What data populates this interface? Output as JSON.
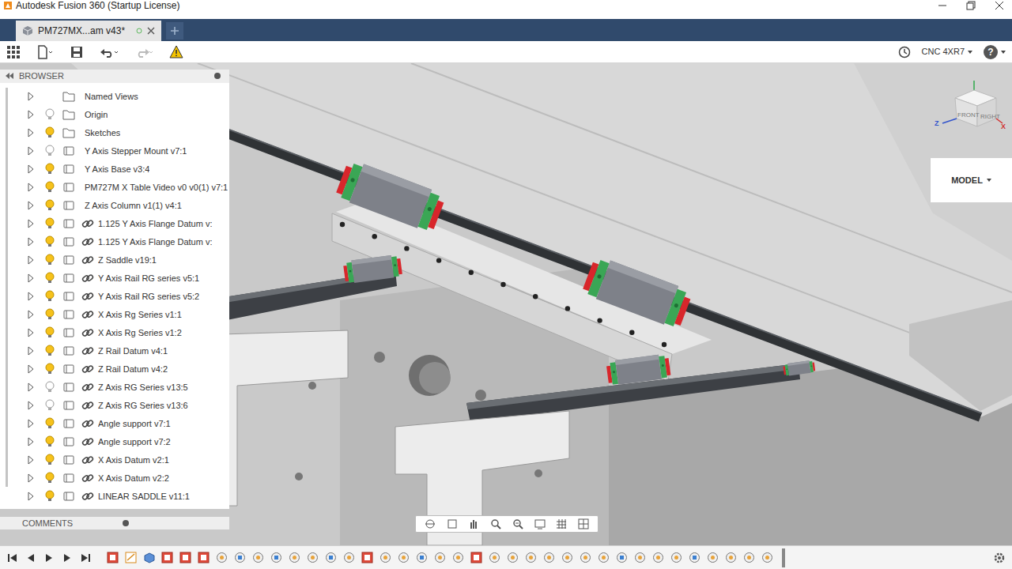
{
  "window": {
    "title": "Autodesk Fusion 360 (Startup License)"
  },
  "tabs": [
    {
      "label": "PM727MX...am v43*",
      "selected": true
    }
  ],
  "toolbar": {
    "workspace": "CNC 4XR7",
    "help": "?"
  },
  "browser": {
    "title": "BROWSER",
    "items": [
      {
        "label": "Named Views",
        "kind": "named-views",
        "visible": false,
        "expanded": false
      },
      {
        "label": "Origin",
        "kind": "folder",
        "visible": false,
        "expanded": false
      },
      {
        "label": "Sketches",
        "kind": "folder",
        "visible": true,
        "expanded": false
      },
      {
        "label": "Y Axis Stepper Mount v7:1",
        "kind": "component",
        "visible": false,
        "expanded": false
      },
      {
        "label": "Y Axis Base v3:4",
        "kind": "component",
        "visible": true,
        "expanded": false
      },
      {
        "label": "PM727M X Table Video v0 v0(1) v7:1",
        "kind": "component",
        "visible": true,
        "expanded": false
      },
      {
        "label": "Z Axis Column v1(1) v4:1",
        "kind": "component",
        "visible": true,
        "expanded": false
      },
      {
        "label": "1.125 Y Axis Flange Datum v:",
        "kind": "linked",
        "visible": true,
        "expanded": false
      },
      {
        "label": "1.125 Y Axis Flange Datum v:",
        "kind": "linked",
        "visible": true,
        "expanded": false
      },
      {
        "label": "Z Saddle v19:1",
        "kind": "linked",
        "visible": true,
        "expanded": false
      },
      {
        "label": "Y Axis Rail RG series v5:1",
        "kind": "linked",
        "visible": true,
        "expanded": false
      },
      {
        "label": "Y Axis Rail RG series v5:2",
        "kind": "linked",
        "visible": true,
        "expanded": false
      },
      {
        "label": "X Axis Rg Series v1:1",
        "kind": "linked",
        "visible": true,
        "expanded": false
      },
      {
        "label": "X Axis Rg Series v1:2",
        "kind": "linked",
        "visible": true,
        "expanded": false
      },
      {
        "label": "Z Rail Datum v4:1",
        "kind": "linked",
        "visible": true,
        "expanded": false
      },
      {
        "label": "Z Rail Datum v4:2",
        "kind": "linked",
        "visible": true,
        "expanded": false
      },
      {
        "label": "Z Axis RG Series v13:5",
        "kind": "linked",
        "visible": false,
        "expanded": false
      },
      {
        "label": "Z Axis RG Series v13:6",
        "kind": "linked",
        "visible": false,
        "expanded": false
      },
      {
        "label": "Angle support v7:1",
        "kind": "linked",
        "visible": true,
        "expanded": false
      },
      {
        "label": "Angle support v7:2",
        "kind": "linked",
        "visible": true,
        "expanded": false
      },
      {
        "label": "X Axis Datum v2:1",
        "kind": "linked",
        "visible": true,
        "expanded": false
      },
      {
        "label": "X Axis Datum v2:2",
        "kind": "linked",
        "visible": true,
        "expanded": false
      },
      {
        "label": "LINEAR SADDLE v11:1",
        "kind": "linked",
        "visible": true,
        "expanded": false
      }
    ]
  },
  "comments": {
    "title": "COMMENTS"
  },
  "workspace_menu": {
    "label": "MODEL"
  },
  "view_cube": {
    "faces": [
      "FRONT",
      "RIGHT"
    ],
    "axes": [
      {
        "label": "Z",
        "color": "#3355cc"
      },
      {
        "label": "X",
        "color": "#d23030"
      }
    ]
  },
  "timeline": {
    "features": [
      {
        "kind": "component"
      },
      {
        "kind": "sketch"
      },
      {
        "kind": "extrude"
      },
      {
        "kind": "component"
      },
      {
        "kind": "component"
      },
      {
        "kind": "component"
      },
      {
        "kind": "joint"
      },
      {
        "kind": "rigid-joint"
      },
      {
        "kind": "joint"
      },
      {
        "kind": "rigid-joint"
      },
      {
        "kind": "joint"
      },
      {
        "kind": "joint"
      },
      {
        "kind": "rigid-joint"
      },
      {
        "kind": "joint"
      },
      {
        "kind": "component"
      },
      {
        "kind": "joint"
      },
      {
        "kind": "joint"
      },
      {
        "kind": "rigid-joint"
      },
      {
        "kind": "joint"
      },
      {
        "kind": "joint"
      },
      {
        "kind": "component"
      },
      {
        "kind": "joint"
      },
      {
        "kind": "joint"
      },
      {
        "kind": "joint"
      },
      {
        "kind": "joint"
      },
      {
        "kind": "joint"
      },
      {
        "kind": "joint"
      },
      {
        "kind": "joint"
      },
      {
        "kind": "rigid-joint"
      },
      {
        "kind": "joint"
      },
      {
        "kind": "joint"
      },
      {
        "kind": "joint"
      },
      {
        "kind": "rigid-joint"
      },
      {
        "kind": "joint"
      },
      {
        "kind": "joint"
      },
      {
        "kind": "joint"
      },
      {
        "kind": "joint"
      }
    ]
  }
}
